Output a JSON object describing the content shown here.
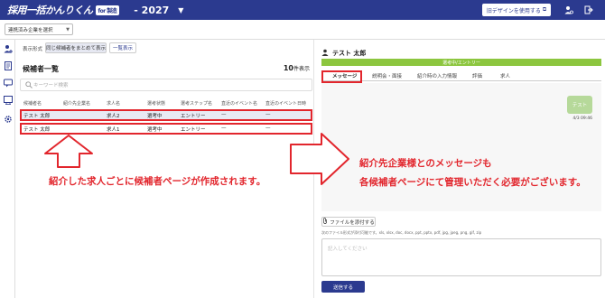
{
  "header": {
    "logo_text": "採用一括かんりくん",
    "logo_badge": "for 製造",
    "year": "- 2027",
    "old_design_label": "旧デザインを使用する"
  },
  "subbar": {
    "company_select": "連携済み企業を選択"
  },
  "left_panel": {
    "display_label": "表示形式",
    "view_grouped": "同じ候補者をまとめて表示",
    "view_list": "一覧表示",
    "title": "候補者一覧",
    "count_number": "10",
    "count_unit": "件表示",
    "search_placeholder": "キーワード検索",
    "columns": [
      "候補者名",
      "紹介先企業名",
      "求人名",
      "選考状態",
      "選考ステップ名",
      "直近のイベント名",
      "直近のイベント日時"
    ],
    "rows": [
      {
        "name": "テスト 太郎",
        "company": "",
        "job": "求人2",
        "status": "選考中",
        "step": "エントリー",
        "event": "—",
        "event_date": "—"
      },
      {
        "name": "テスト 太郎",
        "company": "",
        "job": "求人1",
        "status": "選考中",
        "step": "エントリー",
        "event": "—",
        "event_date": "—"
      }
    ]
  },
  "right_panel": {
    "candidate_name": "テスト 太郎",
    "status": "選考中/エントリー",
    "tabs": [
      "メッセージ",
      "説明会・面接",
      "紹介時の入力情報",
      "評価",
      "求人"
    ],
    "message_bubble": "テスト",
    "message_time": "4/3 09:46",
    "attach_button": "ファイルを添付する",
    "attach_note": "次のファイル形式が添付可能です。xls, xlsx, doc, docx, ppt, pptx, pdf, jpg, jpeg, png, gif, zip",
    "input_placeholder": "記入してください",
    "send_button": "送信する"
  },
  "annotations": {
    "left_text": "紹介した求人ごとに候補者ページが作成されます。",
    "right_text_1": "紹介先企業様とのメッセージも",
    "right_text_2": "各候補者ページにて管理いただく必要がございます。"
  },
  "colors": {
    "brand": "#2b3a8f",
    "status_green": "#8cc63f",
    "highlight_red": "#e2262d"
  }
}
